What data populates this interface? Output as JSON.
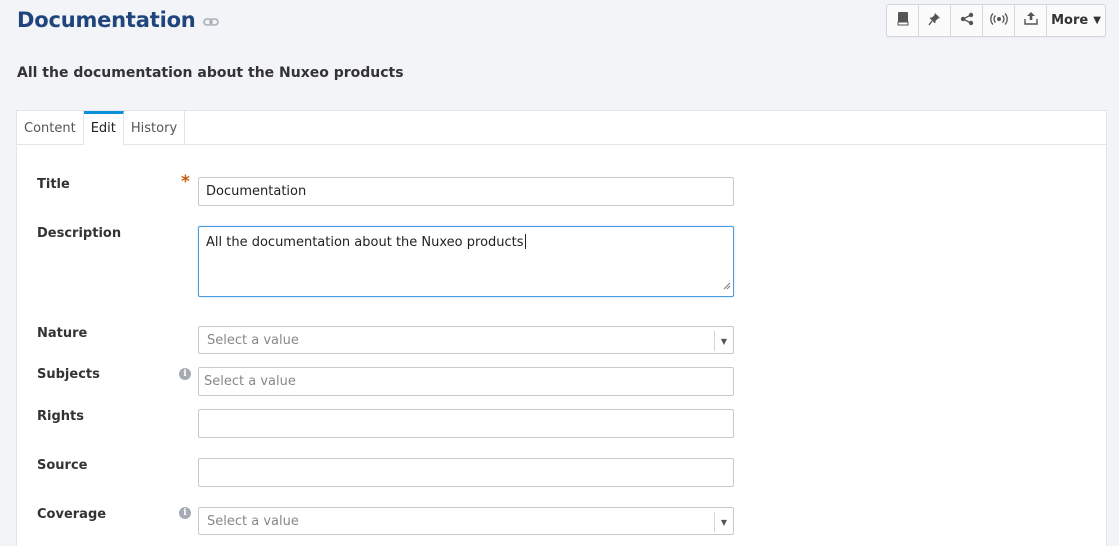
{
  "header": {
    "title": "Documentation",
    "subtitle": "All the documentation about the Nuxeo products"
  },
  "toolbar": {
    "buttons": [
      {
        "icon": "book-icon"
      },
      {
        "icon": "pin-icon"
      },
      {
        "icon": "share-icon"
      },
      {
        "icon": "broadcast-icon"
      },
      {
        "icon": "upload-icon"
      }
    ],
    "more_label": "More",
    "more_caret": "▼"
  },
  "tabs": [
    {
      "label": "Content",
      "active": false
    },
    {
      "label": "Edit",
      "active": true
    },
    {
      "label": "History",
      "active": false
    }
  ],
  "form": {
    "title": {
      "label": "Title",
      "required_mark": "*",
      "value": "Documentation"
    },
    "description": {
      "label": "Description",
      "value": "All the documentation about the Nuxeo products"
    },
    "nature": {
      "label": "Nature",
      "placeholder": "Select a value"
    },
    "subjects": {
      "label": "Subjects",
      "info": "i",
      "placeholder": "Select a value"
    },
    "rights": {
      "label": "Rights",
      "value": ""
    },
    "source": {
      "label": "Source",
      "value": ""
    },
    "coverage": {
      "label": "Coverage",
      "info": "i",
      "placeholder": "Select a value"
    }
  },
  "colors": {
    "title": "#20457c",
    "active_tab": "#0a8fd9",
    "required": "#c85a0a",
    "focus_border": "#4a9be0"
  }
}
